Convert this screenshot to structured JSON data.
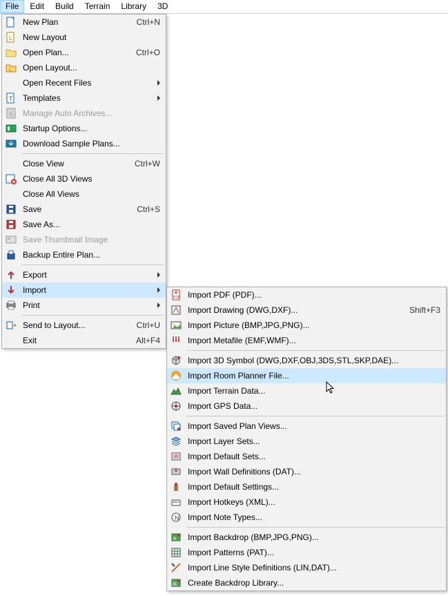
{
  "menubar": {
    "items": [
      "File",
      "Edit",
      "Build",
      "Terrain",
      "Library",
      "3D"
    ],
    "activeIndex": 0
  },
  "fileMenu": [
    {
      "type": "item",
      "icon": "new-plan-icon",
      "label": "New Plan",
      "shortcut": "Ctrl+N"
    },
    {
      "type": "item",
      "icon": "new-layout-icon",
      "label": "New Layout"
    },
    {
      "type": "item",
      "icon": "open-plan-icon",
      "label": "Open Plan...",
      "shortcut": "Ctrl+O"
    },
    {
      "type": "item",
      "icon": "open-layout-icon",
      "label": "Open Layout..."
    },
    {
      "type": "item",
      "label": "Open Recent Files",
      "submenu": true
    },
    {
      "type": "item",
      "icon": "templates-icon",
      "label": "Templates",
      "submenu": true
    },
    {
      "type": "item",
      "icon": "archive-icon",
      "label": "Manage Auto Archives...",
      "disabled": true
    },
    {
      "type": "item",
      "icon": "startup-icon",
      "label": "Startup Options..."
    },
    {
      "type": "item",
      "icon": "download-icon",
      "label": "Download Sample Plans..."
    },
    {
      "type": "sep"
    },
    {
      "type": "item",
      "label": "Close View",
      "shortcut": "Ctrl+W"
    },
    {
      "type": "item",
      "icon": "close-3d-icon",
      "label": "Close All 3D Views"
    },
    {
      "type": "item",
      "label": "Close All Views"
    },
    {
      "type": "item",
      "icon": "save-icon",
      "label": "Save",
      "shortcut": "Ctrl+S"
    },
    {
      "type": "item",
      "icon": "save-as-icon",
      "label": "Save As..."
    },
    {
      "type": "item",
      "icon": "thumb-icon",
      "label": "Save Thumbnail Image",
      "disabled": true
    },
    {
      "type": "item",
      "icon": "backup-icon",
      "label": "Backup Entire Plan..."
    },
    {
      "type": "sep"
    },
    {
      "type": "item",
      "icon": "export-icon",
      "label": "Export",
      "submenu": true
    },
    {
      "type": "item",
      "icon": "import-icon",
      "label": "Import",
      "submenu": true,
      "highlight": true
    },
    {
      "type": "item",
      "icon": "print-icon",
      "label": "Print",
      "submenu": true
    },
    {
      "type": "sep"
    },
    {
      "type": "item",
      "icon": "send-layout-icon",
      "label": "Send to Layout...",
      "shortcut": "Ctrl+U"
    },
    {
      "type": "item",
      "label": "Exit",
      "shortcut": "Alt+F4"
    }
  ],
  "importMenu": [
    {
      "type": "item",
      "icon": "pdf-icon",
      "label": "Import PDF (PDF)..."
    },
    {
      "type": "item",
      "icon": "dwg-icon",
      "label": "Import Drawing (DWG,DXF)...",
      "shortcut": "Shift+F3"
    },
    {
      "type": "item",
      "icon": "picture-icon",
      "label": "Import Picture (BMP,JPG,PNG)..."
    },
    {
      "type": "item",
      "icon": "metafile-icon",
      "label": "Import Metafile (EMF,WMF)..."
    },
    {
      "type": "sep"
    },
    {
      "type": "item",
      "icon": "symbol-icon",
      "label": "Import 3D Symbol (DWG,DXF,OBJ,3DS,STL,SKP,DAE)..."
    },
    {
      "type": "item",
      "icon": "room-planner-icon",
      "label": "Import Room Planner File...",
      "highlight": true
    },
    {
      "type": "item",
      "icon": "terrain-icon",
      "label": "Import Terrain Data..."
    },
    {
      "type": "item",
      "icon": "gps-icon",
      "label": "Import GPS Data..."
    },
    {
      "type": "sep"
    },
    {
      "type": "item",
      "icon": "saved-views-icon",
      "label": "Import Saved Plan Views..."
    },
    {
      "type": "item",
      "icon": "layer-sets-icon",
      "label": "Import Layer Sets..."
    },
    {
      "type": "item",
      "icon": "default-sets-icon",
      "label": "Import Default Sets..."
    },
    {
      "type": "item",
      "icon": "wall-def-icon",
      "label": "Import Wall Definitions (DAT)..."
    },
    {
      "type": "item",
      "icon": "default-settings-icon",
      "label": "Import Default Settings..."
    },
    {
      "type": "item",
      "icon": "hotkeys-icon",
      "label": "Import Hotkeys (XML)..."
    },
    {
      "type": "item",
      "icon": "note-types-icon",
      "label": "Import Note Types..."
    },
    {
      "type": "sep"
    },
    {
      "type": "item",
      "icon": "backdrop-icon",
      "label": "Import Backdrop (BMP,JPG,PNG)..."
    },
    {
      "type": "item",
      "icon": "patterns-icon",
      "label": "Import Patterns (PAT)..."
    },
    {
      "type": "item",
      "icon": "line-style-icon",
      "label": "Import Line Style Definitions (LIN,DAT)..."
    },
    {
      "type": "item",
      "icon": "create-backdrop-icon",
      "label": "Create Backdrop Library..."
    }
  ]
}
